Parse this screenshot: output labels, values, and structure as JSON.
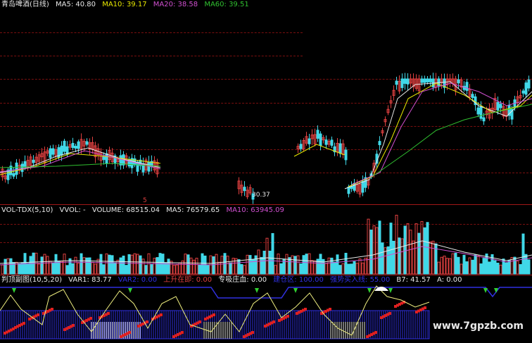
{
  "main": {
    "title": "青岛啤酒(日线)",
    "ma5": "MA5: 40.80",
    "ma10": "MA10: 39.17",
    "ma20": "MA20: 38.58",
    "ma60": "MA60: 39.51",
    "low_label": "30.37",
    "marker_label": "5"
  },
  "volume": {
    "indicator": "VOL-TDX(5,10)",
    "vvol": "VVOL: -",
    "volume": "VOLUME: 68515.04",
    "ma5": "MA5: 76579.65",
    "ma10": "MA10: 63945.09"
  },
  "sub": {
    "indicator": "判顶副图(10,5,20)",
    "var1": "VAR1: 83.77",
    "var2": "VAR2: 0.00",
    "rising": "上升在即: 0.00",
    "accumulate": "专吸庄血: 0.00",
    "build": "建仓区: 100.00",
    "buy": "强势买入线: 55.00",
    "b7": "B7: 41.57",
    "a": "A: 0.00"
  },
  "watermark": "www.7gpzb.com",
  "colors": {
    "ma5": "#e8e8e8",
    "ma10": "#e8e800",
    "ma20": "#d050d0",
    "ma60": "#30c030",
    "up": "#e04040",
    "down": "#40d8e8",
    "grid": "#7a0f0f",
    "blue": "#3030e0"
  }
}
